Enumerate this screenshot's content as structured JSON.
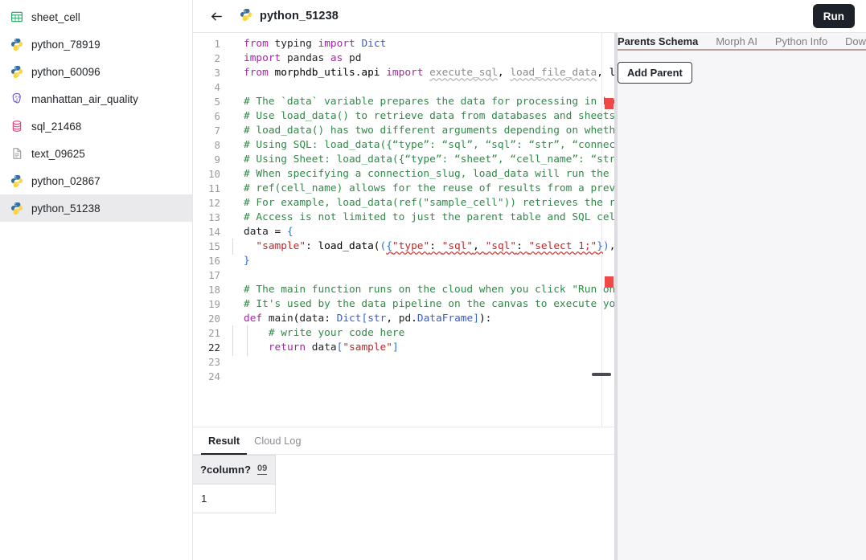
{
  "sidebar": {
    "items": [
      {
        "label": "sheet_cell",
        "icon": "sheet-icon",
        "active": false
      },
      {
        "label": "python_78919",
        "icon": "python-icon",
        "active": false
      },
      {
        "label": "python_60096",
        "icon": "python-icon",
        "active": false
      },
      {
        "label": "manhattan_air_quality",
        "icon": "postgres-icon",
        "active": false
      },
      {
        "label": "sql_21468",
        "icon": "database-icon",
        "active": false
      },
      {
        "label": "text_09625",
        "icon": "document-icon",
        "active": false
      },
      {
        "label": "python_02867",
        "icon": "python-icon",
        "active": false
      },
      {
        "label": "python_51238",
        "icon": "python-icon",
        "active": true
      }
    ]
  },
  "topbar": {
    "back_icon": "arrow-left-icon",
    "file_icon": "python-icon",
    "title": "python_51238",
    "run_label": "Run"
  },
  "editor": {
    "active_line": 22,
    "total_lines": 24,
    "lines": [
      {
        "n": 1,
        "text": "from typing import Dict"
      },
      {
        "n": 2,
        "text": "import pandas as pd"
      },
      {
        "n": 3,
        "text": "from morphdb_utils.api import execute_sql, load_file_data, load"
      },
      {
        "n": 4,
        "text": ""
      },
      {
        "n": 5,
        "text": "# The `data` variable prepares the data for processing in both t"
      },
      {
        "n": 6,
        "text": "# Use load_data() to retrieve data from databases and sheets."
      },
      {
        "n": 7,
        "text": "# load_data() has two different arguments depending on whether i"
      },
      {
        "n": 8,
        "text": "# Using SQL: load_data({“type”: “sql”, “sql”: “str”, “connection"
      },
      {
        "n": 9,
        "text": "# Using Sheet: load_data({“type”: “sheet”, “cell_name”: “str”, “"
      },
      {
        "n": 10,
        "text": "# When specifying a connection_slug, load_data will run the SQL "
      },
      {
        "n": 11,
        "text": "# ref(cell_name) allows for the reuse of results from a previous"
      },
      {
        "n": 12,
        "text": "# For example, load_data(ref(\"sample_cell\")) retrieves the resul"
      },
      {
        "n": 13,
        "text": "# Access is not limited to just the parent table and SQL cells c"
      },
      {
        "n": 14,
        "text": "data = {"
      },
      {
        "n": 15,
        "text": "  \"sample\": load_data({\"type\": \"sql\", \"sql\": \"select 1;\"}),"
      },
      {
        "n": 16,
        "text": "}"
      },
      {
        "n": 17,
        "text": ""
      },
      {
        "n": 18,
        "text": "# The main function runs on the cloud when you click \"Run on Clo"
      },
      {
        "n": 19,
        "text": "# It's used by the data pipeline on the canvas to execute your D"
      },
      {
        "n": 20,
        "text": "def main(data: Dict[str, pd.DataFrame]):"
      },
      {
        "n": 21,
        "text": "    # write your code here"
      },
      {
        "n": 22,
        "text": "    return data[\"sample\"]"
      },
      {
        "n": 23,
        "text": ""
      },
      {
        "n": 24,
        "text": ""
      }
    ]
  },
  "results": {
    "tabs": [
      {
        "label": "Result",
        "active": true
      },
      {
        "label": "Cloud Log",
        "active": false
      }
    ],
    "table": {
      "columns": [
        {
          "name": "?column?",
          "type_badge": "09"
        }
      ],
      "rows": [
        [
          "1"
        ]
      ]
    }
  },
  "right_panel": {
    "tabs": [
      {
        "label": "Parents Schema",
        "active": true
      },
      {
        "label": "Morph AI",
        "active": false
      },
      {
        "label": "Python Info",
        "active": false
      },
      {
        "label": "Download",
        "active": false
      }
    ],
    "add_parent_label": "Add Parent"
  },
  "colors": {
    "accent_dark": "#1d2129",
    "tab_underline": "#b9a09a",
    "sidebar_active": "#eaeaec",
    "panel_bg": "#f6f6f8",
    "error_marker": "#f04747",
    "comment": "#2c8c46",
    "keyword": "#a626a4",
    "string": "#c22626"
  }
}
